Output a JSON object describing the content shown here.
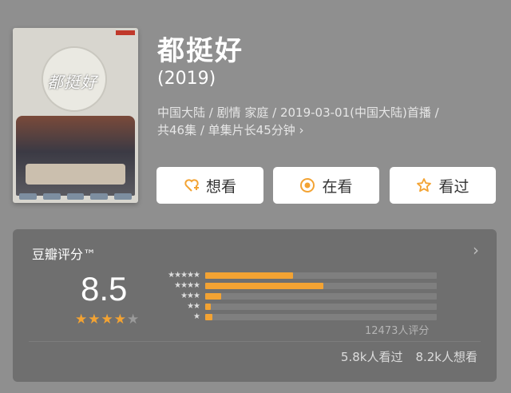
{
  "poster": {
    "title_art": "都挺好"
  },
  "movie": {
    "title": "都挺好",
    "year": "(2019)",
    "meta_line1": "中国大陆 / 剧情 家庭 / 2019-03-01(中国大陆)首播 /",
    "meta_line2": "共46集 / 单集片长45分钟 ›"
  },
  "actions": [
    {
      "label": "想看",
      "icon": "heart-plus-icon"
    },
    {
      "label": "在看",
      "icon": "target-circle-icon"
    },
    {
      "label": "看过",
      "icon": "star-outline-icon"
    }
  ],
  "rating": {
    "label": "豆瓣评分™",
    "score": "8.5",
    "stars_filled": 4,
    "stars_total": 5,
    "distribution": [
      {
        "stars": "★★★★★",
        "fraction": 0.38
      },
      {
        "stars": "★★★★",
        "fraction": 0.51
      },
      {
        "stars": "★★★",
        "fraction": 0.07
      },
      {
        "stars": "★★",
        "fraction": 0.025
      },
      {
        "stars": "★",
        "fraction": 0.03
      }
    ],
    "count": "12473人评分",
    "watched": "5.8k人看过",
    "want": "8.2k人想看"
  },
  "colors": {
    "background": "#8f8f8f",
    "card": "#6f6f6f",
    "bar_fill": "#f3a333",
    "star_filled": "#f3a333",
    "star_empty": "#9a9a9a"
  }
}
